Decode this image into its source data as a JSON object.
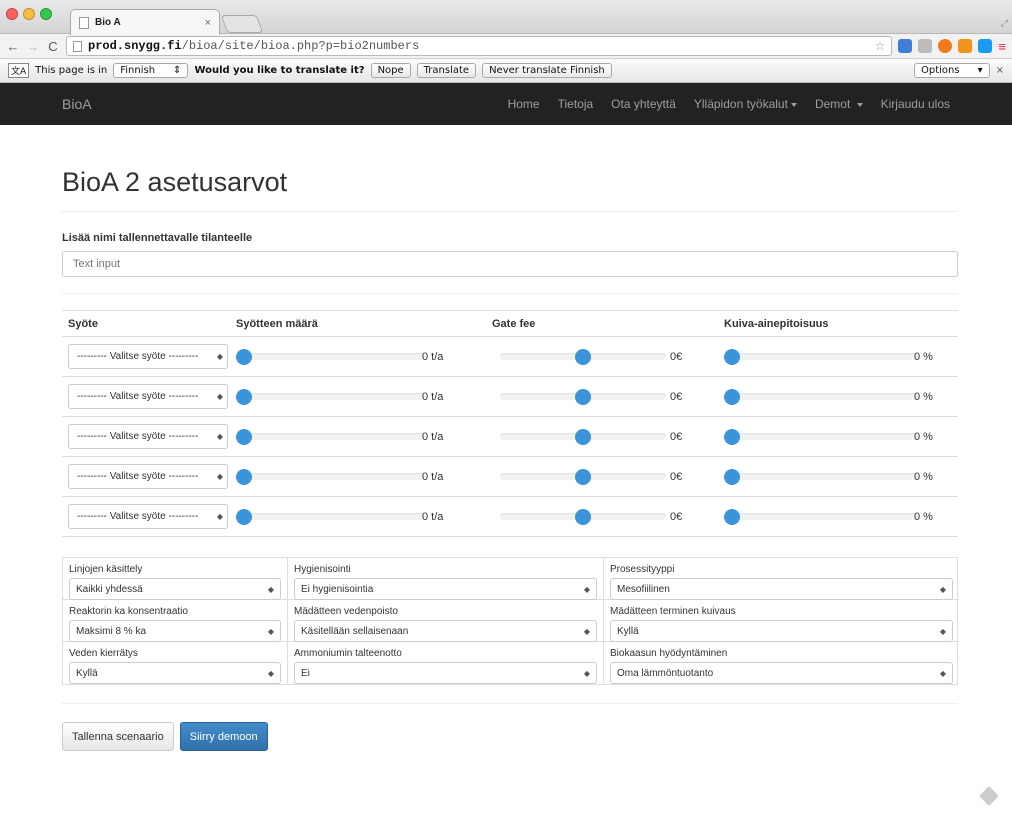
{
  "browser": {
    "tab_title": "Bio A",
    "tab_close": "×",
    "url_host": "prod.snygg.fi",
    "url_path": "/bioa/site/bioa.php?p=bio2numbers",
    "translate": {
      "prefix": "This page is in",
      "language": "Finnish",
      "question": "Would you like to translate it?",
      "nope": "Nope",
      "translate": "Translate",
      "never": "Never translate Finnish",
      "options": "Options",
      "close": "×"
    }
  },
  "navbar": {
    "brand": "BioA",
    "links": {
      "home": "Home",
      "tietoja": "Tietoja",
      "ota": "Ota yhteyttä",
      "yllapidon": "Ylläpidon työkalut",
      "demot": "Demot",
      "logout": "Kirjaudu ulos"
    }
  },
  "page": {
    "title": "BioA 2 asetusarvot",
    "name_label": "Lisää nimi tallennettavalle tilanteelle",
    "name_placeholder": "Text input"
  },
  "feeds": {
    "headers": [
      "Syöte",
      "Syötteen määrä",
      "Gate fee",
      "Kuiva-ainepitoisuus"
    ],
    "rows": [
      {
        "select": "--------- Valitse syöte ---------",
        "amount": 0,
        "amount_text": "0 t/a",
        "gate_fee": 0.5,
        "gate_text": "0€",
        "dry": 0,
        "dry_text": "0 %"
      },
      {
        "select": "--------- Valitse syöte ---------",
        "amount": 0,
        "amount_text": "0 t/a",
        "gate_fee": 0.5,
        "gate_text": "0€",
        "dry": 0,
        "dry_text": "0 %"
      },
      {
        "select": "--------- Valitse syöte ---------",
        "amount": 0,
        "amount_text": "0 t/a",
        "gate_fee": 0.5,
        "gate_text": "0€",
        "dry": 0,
        "dry_text": "0 %"
      },
      {
        "select": "--------- Valitse syöte ---------",
        "amount": 0,
        "amount_text": "0 t/a",
        "gate_fee": 0.5,
        "gate_text": "0€",
        "dry": 0,
        "dry_text": "0 %"
      },
      {
        "select": "--------- Valitse syöte ---------",
        "amount": 0,
        "amount_text": "0 t/a",
        "gate_fee": 0.5,
        "gate_text": "0€",
        "dry": 0,
        "dry_text": "0 %"
      }
    ]
  },
  "options": [
    {
      "label": "Linjojen käsittely",
      "value": "Kaikki yhdessä"
    },
    {
      "label": "Hygienisointi",
      "value": "Ei hygienisointia"
    },
    {
      "label": "Prosessityyppi",
      "value": "Mesofiilinen"
    },
    {
      "label": "Reaktorin ka konsentraatio",
      "value": "Maksimi 8 % ka"
    },
    {
      "label": "Mädätteen vedenpoisto",
      "value": "Käsitellään sellaisenaan"
    },
    {
      "label": "Mädätteen terminen kuivaus",
      "value": "Kyllä"
    },
    {
      "label": "Veden kierrätys",
      "value": "Kyllä"
    },
    {
      "label": "Ammoniumin talteenotto",
      "value": "Ei"
    },
    {
      "label": "Biokaasun hyödyntäminen",
      "value": "Oma lämmöntuotanto"
    }
  ],
  "buttons": {
    "save": "Tallenna scenaario",
    "demo": "Siirry demoon"
  },
  "colors": {
    "navbar": "#222222",
    "slider_thumb": "#3b93d9",
    "primary": "#428bca"
  }
}
